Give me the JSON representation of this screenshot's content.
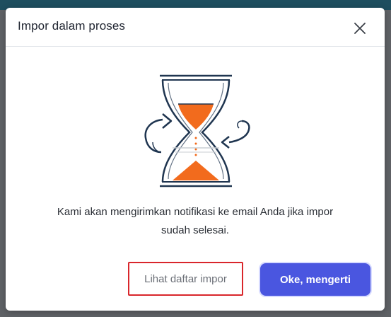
{
  "modal": {
    "title": "Impor dalam proses",
    "message_line1": "Kami akan mengirimkan notifikasi ke email Anda jika impor",
    "message_line2": "sudah selesai.",
    "secondary_button_label": "Lihat daftar impor",
    "primary_button_label": "Oke, mengerti"
  },
  "icons": {
    "close": "close-icon",
    "illustration": "hourglass-icon"
  },
  "colors": {
    "primary": "#4a56e0",
    "accent_orange": "#f26b1d",
    "outline_navy": "#1f3550",
    "highlight_border": "#d9262b"
  }
}
